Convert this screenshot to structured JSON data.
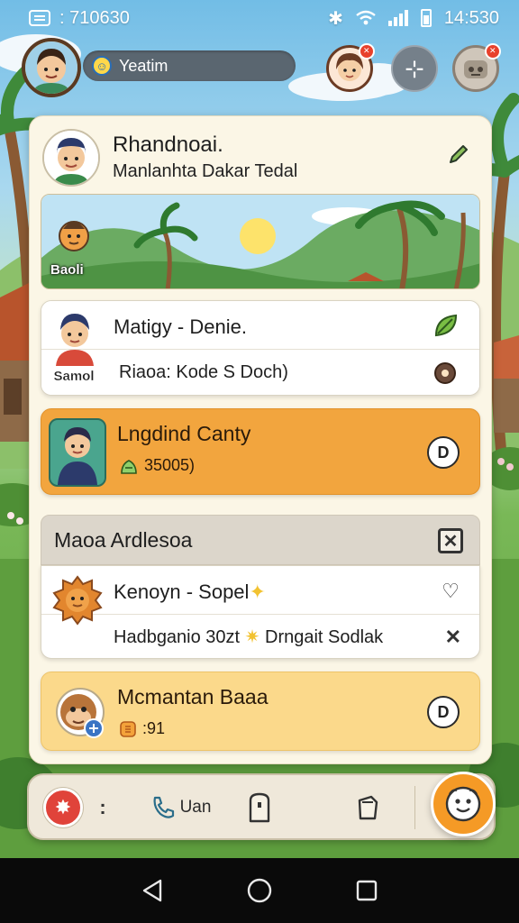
{
  "status_bar": {
    "left_text": ": 710630",
    "time": "14:530"
  },
  "top_bar": {
    "search_text": "Yeatim",
    "icons": [
      "user-avatar",
      "friend-avatar",
      "plus-icon",
      "robot-icon"
    ]
  },
  "profile": {
    "name": "Rhandnoai.",
    "subtitle": "Manlanhta Dakar Tedal",
    "edit_icon": "pencil-icon"
  },
  "banner": {
    "label": "Baoli"
  },
  "cards": [
    {
      "tag": "Samol",
      "title": "Matigy - Denie.",
      "subtitle": "Riaoa: Kode S Doch)",
      "icons": [
        "leaf-icon",
        "record-dot-icon"
      ]
    },
    {
      "title": "Lngdind Canty",
      "subtitle": "35005)",
      "icons": [
        "money-bag-icon",
        "play-icon"
      ],
      "color": "#f2a53e"
    }
  ],
  "section": {
    "title": "Maoa Ardlesoa",
    "close_icon": "close-box-icon",
    "items": [
      {
        "title": "Kenoyn - Sopel",
        "subtitle": "Hadbganio 30zt",
        "subtitle_extra": "Drngait Sodlak",
        "icons": [
          "heart-icon",
          "close-icon"
        ]
      },
      {
        "title": "Mcmantan Baaa",
        "subtitle": ":91",
        "icons": [
          "coin-icon",
          "play-icon"
        ],
        "color": "#fbd98b"
      }
    ]
  },
  "dock": {
    "colon": ":",
    "call_label": "Uan",
    "icons": [
      "record-icon",
      "phone-icon",
      "document-icon",
      "tag-icon",
      "smiley-icon"
    ]
  },
  "nav": {
    "icons": [
      "back-icon",
      "home-icon",
      "recents-icon"
    ]
  }
}
